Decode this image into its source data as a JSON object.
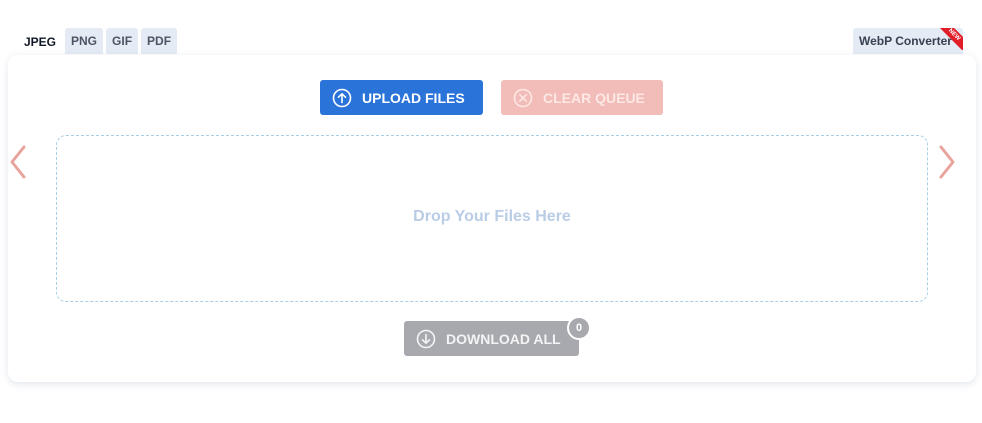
{
  "tabs": [
    {
      "label": "JPEG",
      "active": true
    },
    {
      "label": "PNG",
      "active": false
    },
    {
      "label": "GIF",
      "active": false
    },
    {
      "label": "PDF",
      "active": false
    }
  ],
  "webp_tab": {
    "label": "WebP Converter",
    "ribbon": "NEW"
  },
  "toolbar": {
    "upload_label": "UPLOAD FILES",
    "clear_label": "CLEAR QUEUE"
  },
  "dropzone": {
    "text": "Drop Your Files Here"
  },
  "download": {
    "label": "DOWNLOAD ALL",
    "count": "0"
  },
  "icons": {
    "upload": "arrow-up-circle-icon",
    "clear": "x-circle-icon",
    "download": "arrow-down-circle-icon",
    "prev": "chevron-left-icon",
    "next": "chevron-right-icon"
  },
  "colors": {
    "primary": "#2a73d9",
    "clear": "#f2bcb8",
    "download": "#a7a9ae",
    "arrow": "#e8a39b",
    "dropzone_border": "#a9cde4",
    "ribbon": "#e11d28"
  }
}
